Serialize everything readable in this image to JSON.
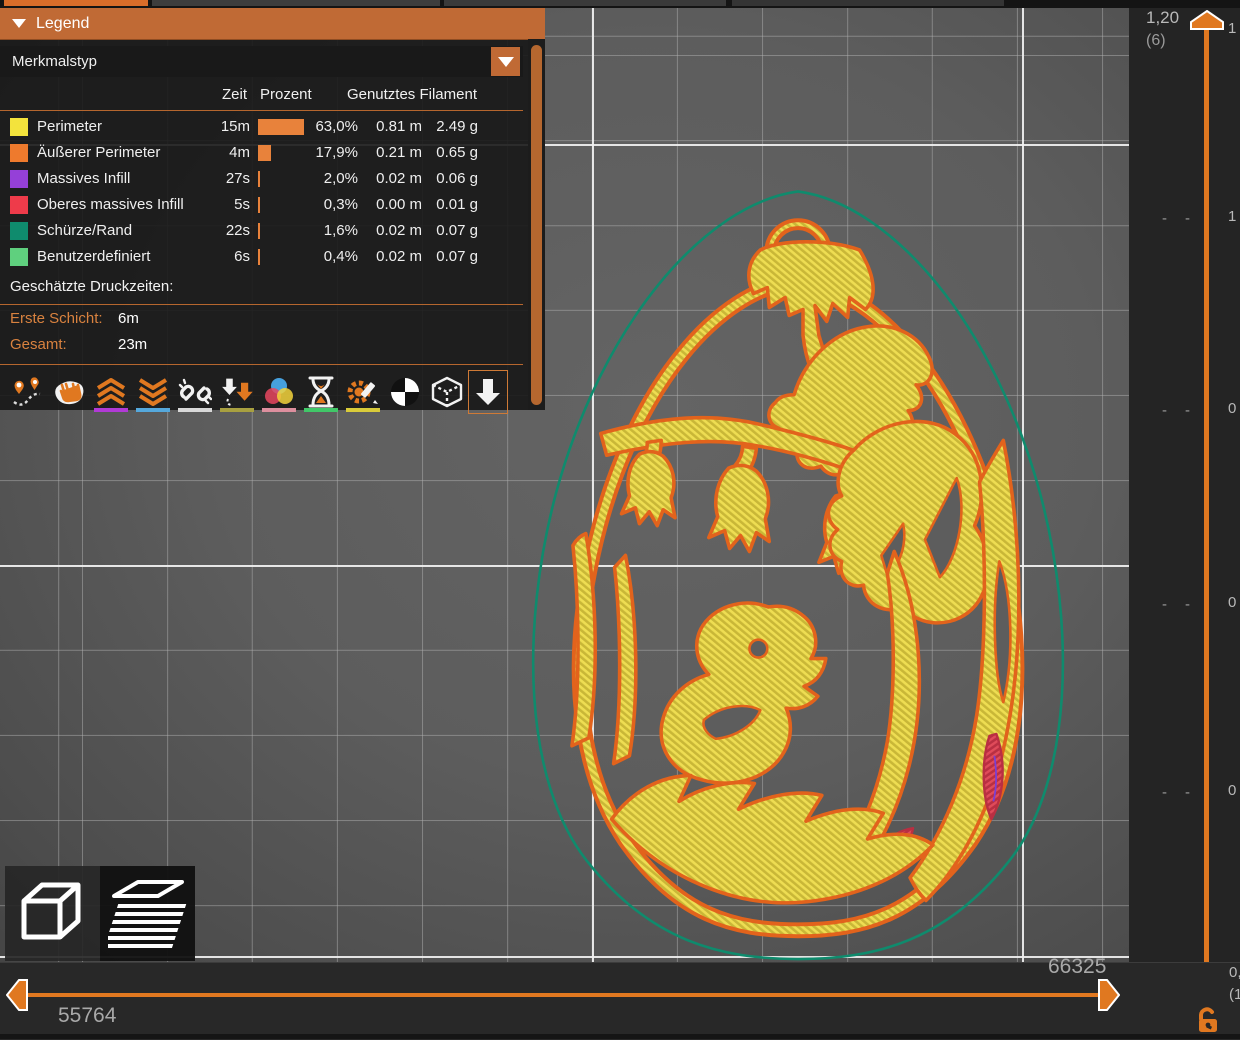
{
  "colors": {
    "accent": "#d96d2a",
    "header": "#c06a35",
    "orange": "#e2631c",
    "yellow": "#e9d84a",
    "yellow_dark": "#c9b737",
    "teal": "#0f8b6d",
    "red": "#d93b4e",
    "viewport_bg": "#5c5c5c"
  },
  "legend": {
    "title": "Legend",
    "dropdown_value": "Merkmalstyp",
    "columns": {
      "time": "Zeit",
      "percent": "Prozent",
      "filament": "Genutztes Filament"
    },
    "rows": [
      {
        "label": "Perimeter",
        "color": "#f3e33c",
        "time": "15m",
        "percent": "63,0%",
        "pct": 63.0,
        "length": "0.81 m",
        "weight": "2.49 g"
      },
      {
        "label": "Äußerer Perimeter",
        "color": "#ee7a2d",
        "time": "4m",
        "percent": "17,9%",
        "pct": 17.9,
        "length": "0.21 m",
        "weight": "0.65 g"
      },
      {
        "label": "Massives Infill",
        "color": "#9540d8",
        "time": "27s",
        "percent": "2,0%",
        "pct": 2.0,
        "length": "0.02 m",
        "weight": "0.06 g"
      },
      {
        "label": "Oberes massives Infill",
        "color": "#ee3b4a",
        "time": "5s",
        "percent": "0,3%",
        "pct": 0.3,
        "length": "0.00 m",
        "weight": "0.01 g"
      },
      {
        "label": "Schürze/Rand",
        "color": "#0f8b6d",
        "time": "22s",
        "percent": "1,6%",
        "pct": 1.6,
        "length": "0.02 m",
        "weight": "0.07 g"
      },
      {
        "label": "Benutzerdefiniert",
        "color": "#5fd07e",
        "time": "6s",
        "percent": "0,4%",
        "pct": 0.4,
        "length": "0.02 m",
        "weight": "0.07 g"
      }
    ],
    "print_times_header": "Geschätzte Druckzeiten:",
    "first_layer_label": "Erste Schicht:",
    "first_layer_value": "6m",
    "total_label": "Gesamt:",
    "total_value": "23m",
    "icon_underline_colors": {
      "retractions": "#b13ad6",
      "deretractions": "#55a8dc",
      "seams": "#d8d8d8",
      "tool_changes": "#a8a040",
      "color_changes": "#dd8f9e",
      "print_pauses": "#41c768",
      "custom_gcodes": "#d9cb3a"
    }
  },
  "sliders": {
    "vertical": {
      "top_value": "1,20",
      "top_layer": "(6)",
      "tick_dash": "-",
      "tick_labels_clipped": [
        "1",
        "1",
        "0",
        "0",
        "0"
      ],
      "bottom_value_clipped": "0,",
      "bottom_layer_clipped": "(1"
    },
    "horizontal": {
      "min_label": "55764",
      "max_label": "66325"
    }
  }
}
